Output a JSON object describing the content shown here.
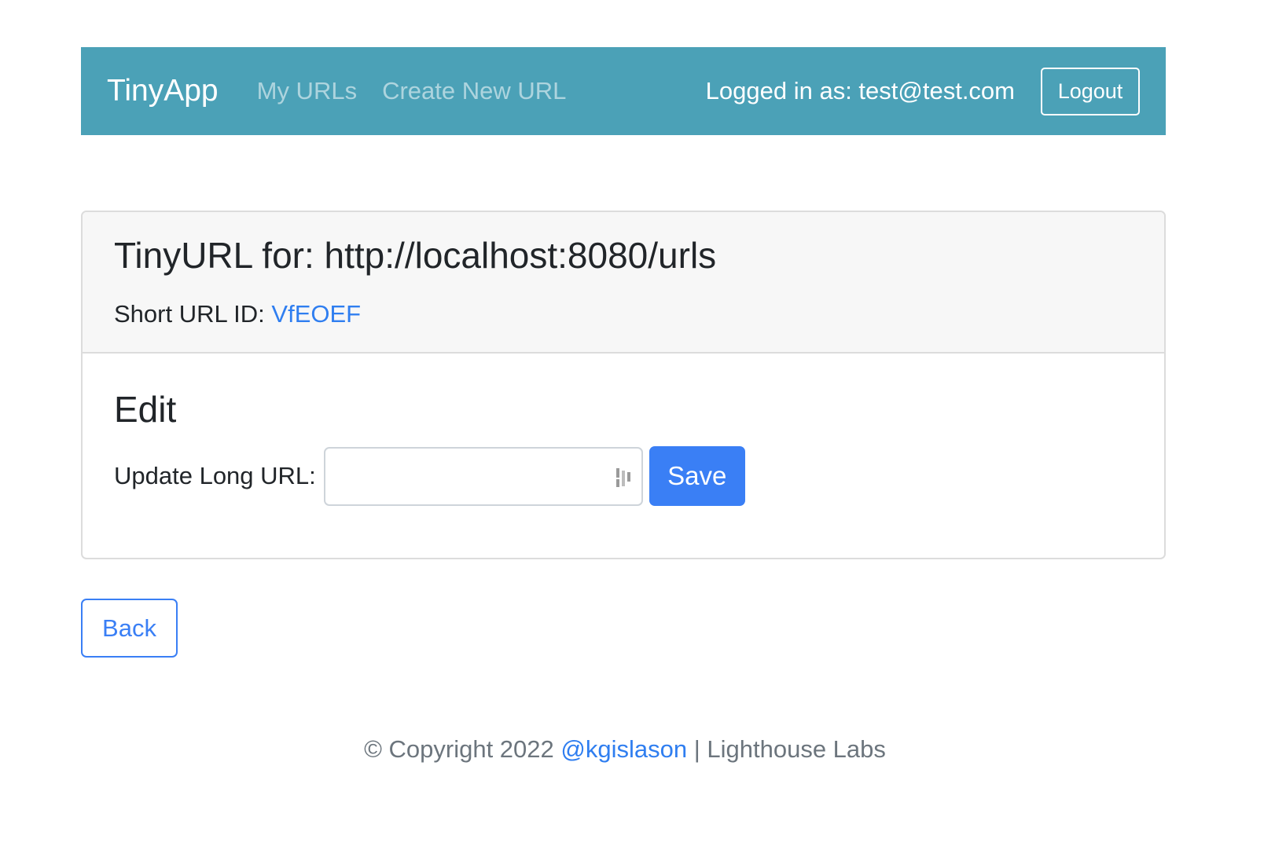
{
  "navbar": {
    "brand": "TinyApp",
    "links": [
      "My URLs",
      "Create New URL"
    ],
    "logged_in_text": "Logged in as: test@test.com",
    "logout_label": "Logout",
    "bg_color": "#4ba1b7"
  },
  "card": {
    "title": "TinyURL for: http://localhost:8080/urls",
    "short_id_label": "Short URL ID: ",
    "short_id_value": "VfEOEF",
    "edit_title": "Edit",
    "update_label": "Update Long URL:",
    "input_value": "",
    "save_label": "Save"
  },
  "back_label": "Back",
  "footer": {
    "copyright": "© Copyright 2022 ",
    "handle": "@kgislason",
    "separator": " | Lighthouse Labs"
  },
  "icons": [
    "password-manager-icon"
  ],
  "colors": {
    "primary": "#3a7ff5",
    "link": "#2f7ef0",
    "muted": "#6c757d"
  }
}
